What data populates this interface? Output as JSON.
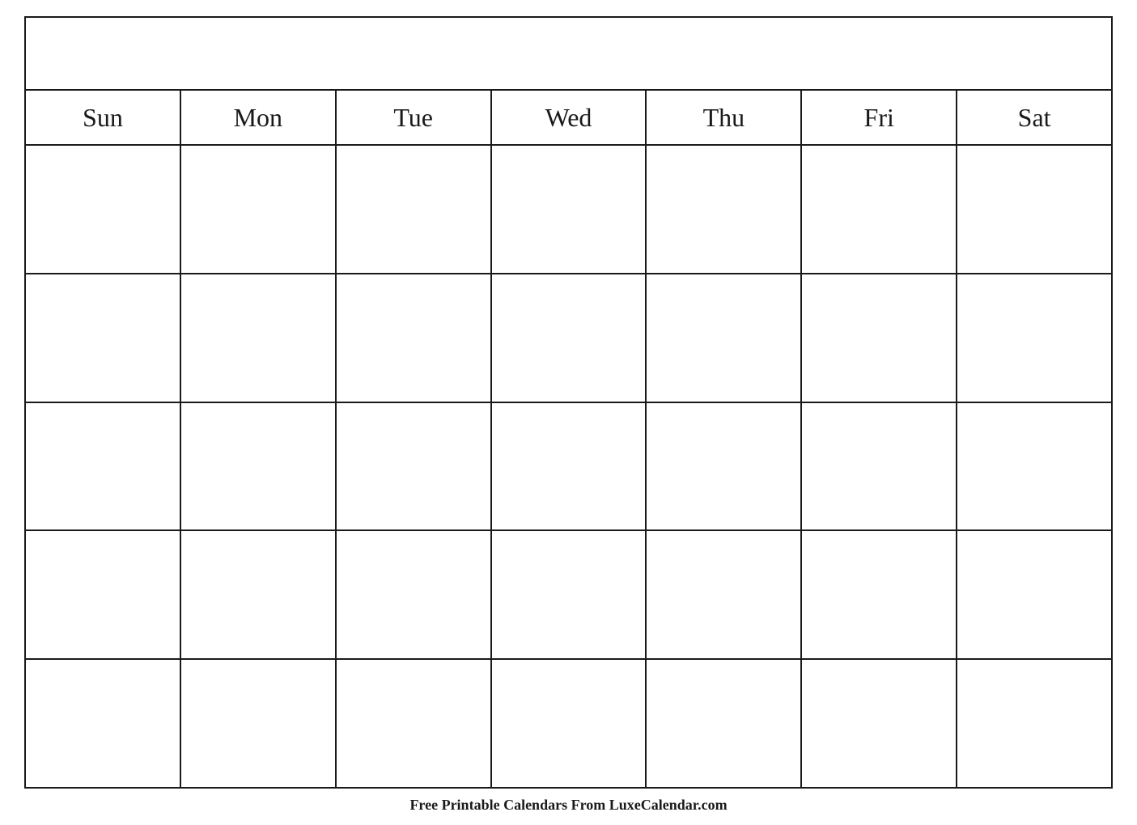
{
  "calendar": {
    "title": "",
    "days": [
      "Sun",
      "Mon",
      "Tue",
      "Wed",
      "Thu",
      "Fri",
      "Sat"
    ],
    "weeks": 5
  },
  "footer": {
    "text": "Free Printable Calendars From LuxeCalendar.com"
  }
}
